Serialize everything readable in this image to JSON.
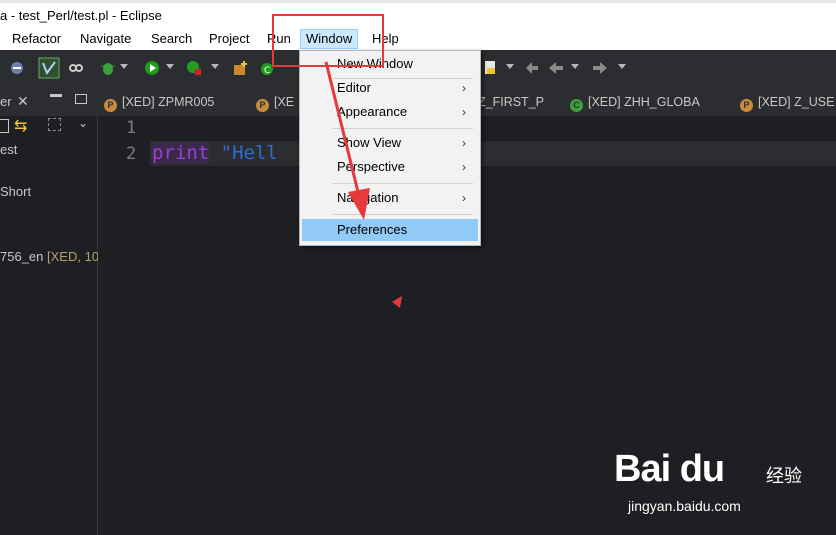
{
  "window": {
    "title": "a - test_Perl/test.pl - Eclipse"
  },
  "menu": {
    "items": [
      "Refactor",
      "Navigate",
      "Search",
      "Project",
      "Run",
      "Window",
      "Help"
    ],
    "active": "Window"
  },
  "tabs": [
    {
      "icon": "P",
      "label": "[XED] ZPMR005"
    },
    {
      "icon": "P",
      "label": "[XE"
    },
    {
      "icon": "",
      "label": "Z_FIRST_P"
    },
    {
      "icon": "C",
      "label": "[XED] ZHH_GLOBA"
    },
    {
      "icon": "P",
      "label": "[XED] Z_USE"
    }
  ],
  "left_panel": {
    "header_label": "er",
    "items": [
      "est",
      "Short"
    ],
    "entry": {
      "name": "756_en",
      "meta": "[XED, 10"
    }
  },
  "editor": {
    "line_numbers": [
      "1",
      "2"
    ],
    "code": {
      "keyword": "print",
      "string": "\"Hell"
    }
  },
  "window_menu": {
    "items": [
      {
        "label": "New Window",
        "submenu": false,
        "selected": false
      },
      {
        "label": "Editor",
        "submenu": true,
        "selected": false
      },
      {
        "label": "Appearance",
        "submenu": true,
        "selected": false
      },
      {
        "label": "Show View",
        "submenu": true,
        "selected": false
      },
      {
        "label": "Perspective",
        "submenu": true,
        "selected": false
      },
      {
        "label": "Navigation",
        "submenu": true,
        "selected": false
      },
      {
        "label": "Preferences",
        "submenu": false,
        "selected": true
      }
    ]
  },
  "watermark": {
    "logo": "Bai du",
    "pre": "经验",
    "url": "jingyan.baidu.com"
  },
  "colors": {
    "annotation_red": "#e8383b",
    "menu_selection": "#91c9f7",
    "editor_bg": "#1e1f22"
  }
}
